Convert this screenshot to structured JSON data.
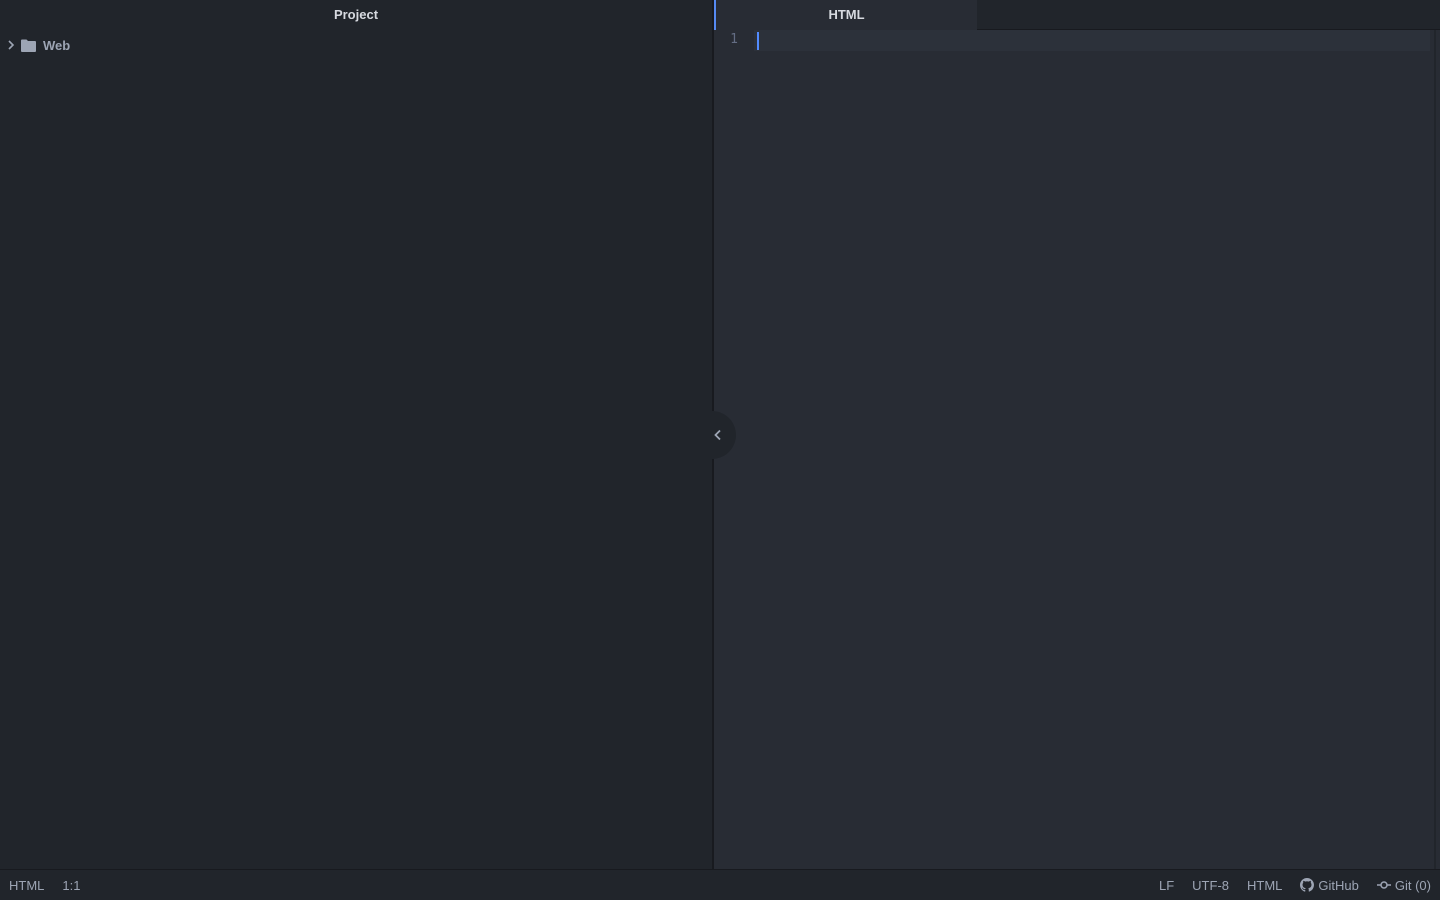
{
  "tree_view": {
    "header": "Project",
    "items": [
      {
        "label": "Web",
        "icon": "folder-icon",
        "expanded": false
      }
    ]
  },
  "editor": {
    "tabs": [
      {
        "label": "HTML",
        "active": true
      }
    ],
    "line_numbers": [
      "1"
    ],
    "content": ""
  },
  "status_bar": {
    "grammar": "HTML",
    "cursor_position": "1:1",
    "line_ending": "LF",
    "encoding": "UTF-8",
    "grammar_right": "HTML",
    "github_label": "GitHub",
    "git_label": "Git (0)"
  },
  "colors": {
    "background": "#21252b",
    "editor_background": "#282c34",
    "accent": "#568af2",
    "text": "#9da5b4",
    "text_highlight": "#d7dae0"
  }
}
